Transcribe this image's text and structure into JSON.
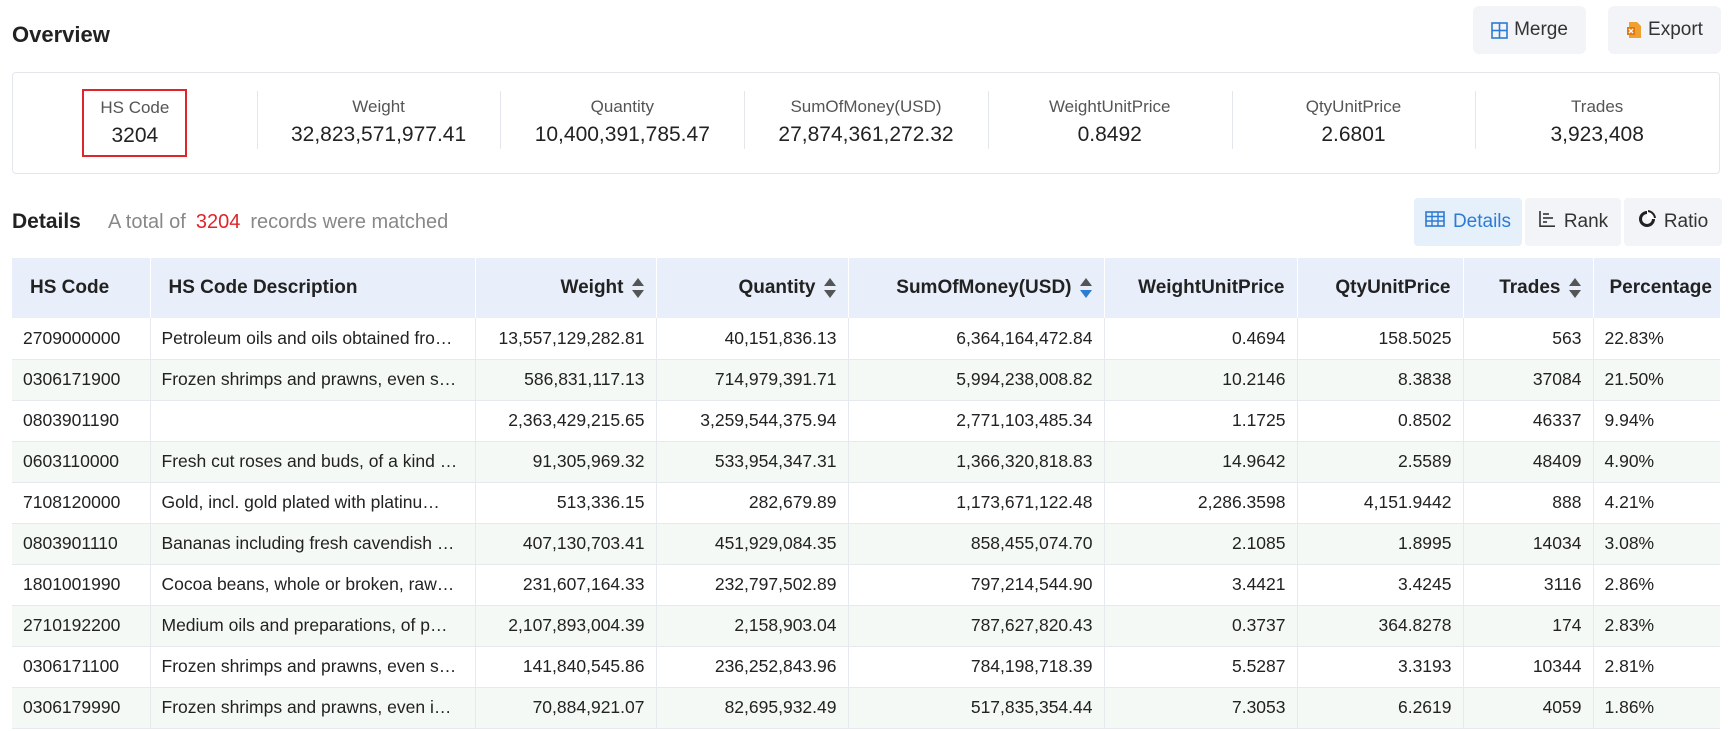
{
  "overview": {
    "title": "Overview",
    "merge_label": "Merge",
    "export_label": "Export",
    "stats": [
      {
        "label": "HS Code",
        "value": "3204"
      },
      {
        "label": "Weight",
        "value": "32,823,571,977.41"
      },
      {
        "label": "Quantity",
        "value": "10,400,391,785.47"
      },
      {
        "label": "SumOfMoney(USD)",
        "value": "27,874,361,272.32"
      },
      {
        "label": "WeightUnitPrice",
        "value": "0.8492"
      },
      {
        "label": "QtyUnitPrice",
        "value": "2.6801"
      },
      {
        "label": "Trades",
        "value": "3,923,408"
      }
    ]
  },
  "details": {
    "title": "Details",
    "summary_prefix": "A total of",
    "summary_count": "3204",
    "summary_suffix": "records were matched",
    "tabs": [
      {
        "label": "Details",
        "icon": "table-icon",
        "active": true
      },
      {
        "label": "Rank",
        "icon": "rank-icon",
        "active": false
      },
      {
        "label": "Ratio",
        "icon": "ratio-icon",
        "active": false
      }
    ]
  },
  "table": {
    "columns": [
      "HS Code",
      "HS Code Description",
      "Weight",
      "Quantity",
      "SumOfMoney(USD)",
      "WeightUnitPrice",
      "QtyUnitPrice",
      "Trades",
      "Percentage"
    ],
    "rows": [
      [
        "2709000000",
        "Petroleum oils and oils obtained fro…",
        "13,557,129,282.81",
        "40,151,836.13",
        "6,364,164,472.84",
        "0.4694",
        "158.5025",
        "563",
        "22.83%"
      ],
      [
        "0306171900",
        "Frozen shrimps and prawns, even s…",
        "586,831,117.13",
        "714,979,391.71",
        "5,994,238,008.82",
        "10.2146",
        "8.3838",
        "37084",
        "21.50%"
      ],
      [
        "0803901190",
        "",
        "2,363,429,215.65",
        "3,259,544,375.94",
        "2,771,103,485.34",
        "1.1725",
        "0.8502",
        "46337",
        "9.94%"
      ],
      [
        "0603110000",
        "Fresh cut roses and buds, of a kind …",
        "91,305,969.32",
        "533,954,347.31",
        "1,366,320,818.83",
        "14.9642",
        "2.5589",
        "48409",
        "4.90%"
      ],
      [
        "7108120000",
        "Gold, incl. gold plated with platinu…",
        "513,336.15",
        "282,679.89",
        "1,173,671,122.48",
        "2,286.3598",
        "4,151.9442",
        "888",
        "4.21%"
      ],
      [
        "0803901110",
        "Bananas including fresh cavendish …",
        "407,130,703.41",
        "451,929,084.35",
        "858,455,074.70",
        "2.1085",
        "1.8995",
        "14034",
        "3.08%"
      ],
      [
        "1801001990",
        "Cocoa beans, whole or broken, raw…",
        "231,607,164.33",
        "232,797,502.89",
        "797,214,544.90",
        "3.4421",
        "3.4245",
        "3116",
        "2.86%"
      ],
      [
        "2710192200",
        "Medium oils and preparations, of p…",
        "2,107,893,004.39",
        "2,158,903.04",
        "787,627,820.43",
        "0.3737",
        "364.8278",
        "174",
        "2.83%"
      ],
      [
        "0306171100",
        "Frozen shrimps and prawns, even s…",
        "141,840,545.86",
        "236,252,843.96",
        "784,198,718.39",
        "5.5287",
        "3.3193",
        "10344",
        "2.81%"
      ],
      [
        "0306179990",
        "Frozen shrimps and prawns, even i…",
        "70,884,921.07",
        "82,695,932.49",
        "517,835,354.44",
        "7.3053",
        "6.2619",
        "4059",
        "1.86%"
      ]
    ]
  },
  "colors": {
    "accent": "#2d7bd3",
    "highlight": "#e0242b",
    "header_bg": "#e8eefa"
  }
}
